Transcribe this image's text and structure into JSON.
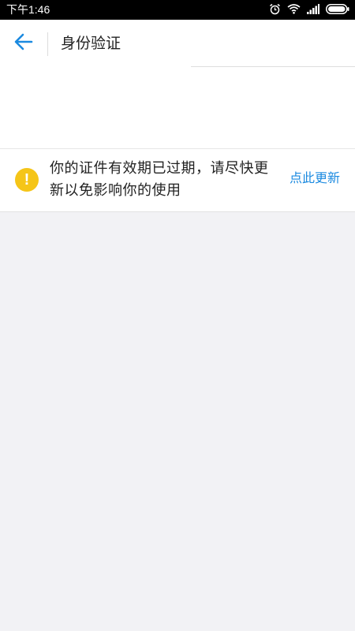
{
  "status_bar": {
    "time": "下午1:46",
    "icons": [
      "alarm-icon",
      "wifi-icon",
      "signal-icon",
      "battery-icon"
    ]
  },
  "header": {
    "back_icon": "arrow-left-icon",
    "title": "身份验证"
  },
  "notice": {
    "icon": "warning-icon",
    "icon_glyph": "!",
    "message": "你的证件有效期已过期，请尽快更新以免影响你的使用",
    "action_label": "点此更新"
  },
  "colors": {
    "accent": "#1b8ae0",
    "warning": "#f5c518",
    "page_background": "#f2f2f5",
    "status_bar": "#000000"
  }
}
